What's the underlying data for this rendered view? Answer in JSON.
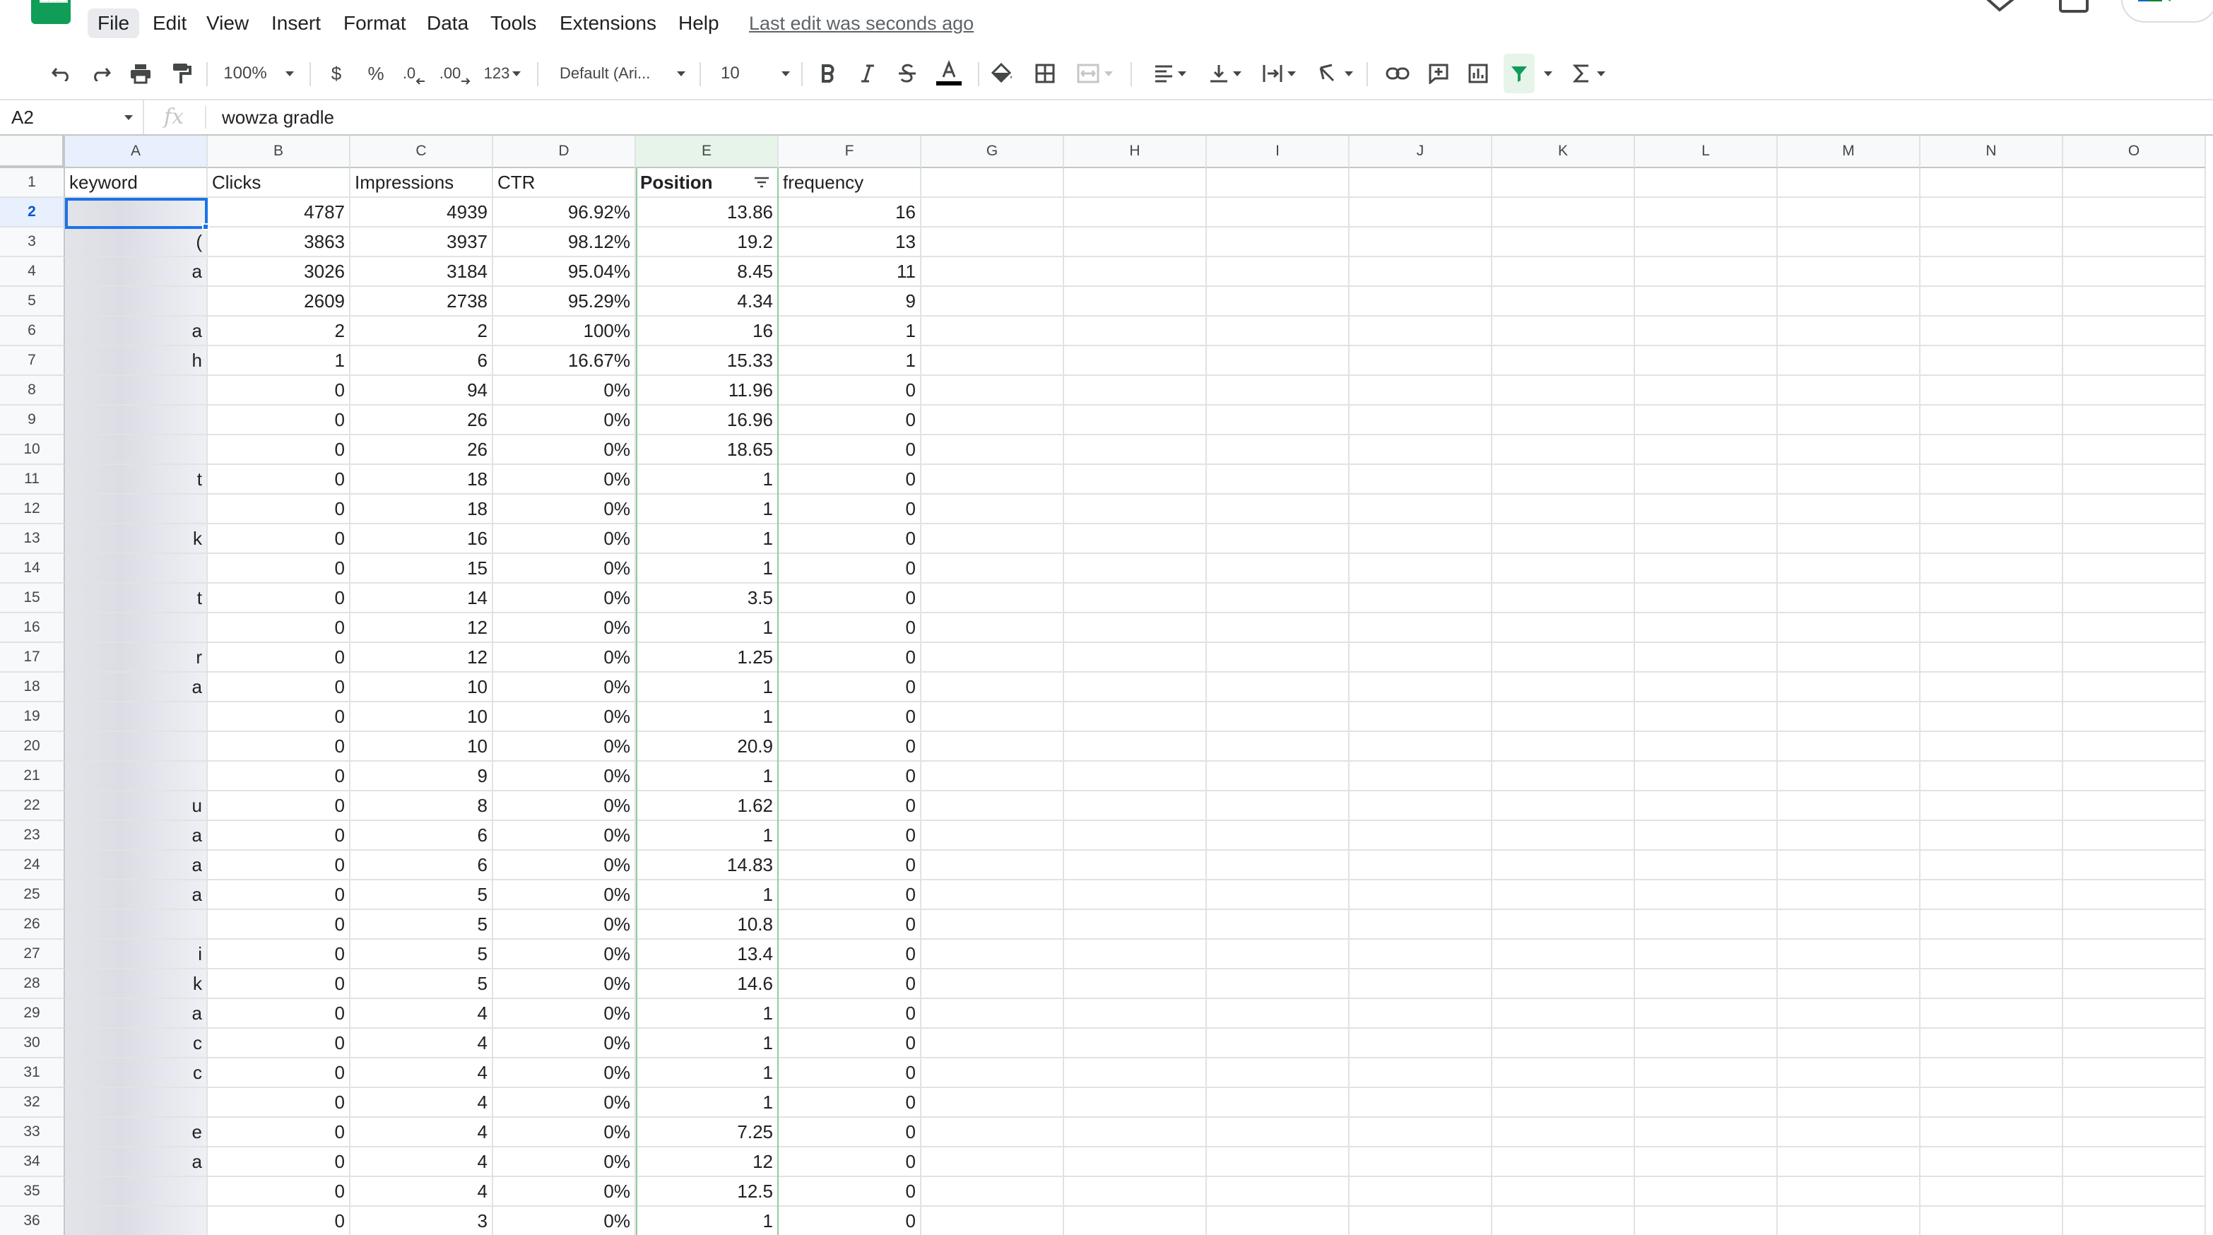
{
  "app": {
    "name": "Google Sheets"
  },
  "menu": {
    "items": [
      "File",
      "Edit",
      "View",
      "Insert",
      "Format",
      "Data",
      "Tools",
      "Extensions",
      "Help"
    ],
    "last_edit": "Last edit was seconds ago"
  },
  "toolbar": {
    "zoom": "100%",
    "currency": "$",
    "percent": "%",
    "decrease_decimals": ".0",
    "increase_decimals": ".00",
    "more_formats": "123",
    "font": "Default (Ari...",
    "font_size": "10"
  },
  "formula_bar": {
    "name_box": "A2",
    "fx": "fx",
    "value": "wowza gradle"
  },
  "colors": {
    "accent": "#1a73e8",
    "filter_active": "#0f9d58",
    "header_bg": "#f8f9fa",
    "grid_line": "#e1e3e1"
  },
  "grid": {
    "columns": [
      "A",
      "B",
      "C",
      "D",
      "E",
      "F",
      "G",
      "H",
      "I",
      "J",
      "K",
      "L",
      "M",
      "N",
      "O"
    ],
    "header_row": [
      "keyword",
      "Clicks",
      "Impressions",
      "CTR",
      "Position",
      "frequency"
    ],
    "row_numbers": [
      "1",
      "2",
      "3",
      "4",
      "5",
      "6",
      "7",
      "8",
      "9",
      "10",
      "11",
      "12",
      "13",
      "14",
      "15",
      "16",
      "17",
      "18",
      "19",
      "20",
      "21",
      "22",
      "23",
      "24",
      "25",
      "26",
      "27",
      "28",
      "29",
      "30",
      "31",
      "32",
      "33",
      "34",
      "35",
      "36"
    ],
    "keyword_tail": [
      "",
      "(",
      "a",
      "",
      "a",
      "h",
      "",
      "",
      "",
      "t",
      "",
      "k",
      "",
      "t",
      "",
      "r",
      "a",
      "",
      "",
      "",
      "u",
      "a",
      "a",
      "a",
      "",
      "i",
      "k",
      "a",
      "c",
      "c",
      "",
      "e",
      "a",
      "",
      ""
    ],
    "rows": [
      [
        "4787",
        "4939",
        "96.92%",
        "13.86",
        "16"
      ],
      [
        "3863",
        "3937",
        "98.12%",
        "19.2",
        "13"
      ],
      [
        "3026",
        "3184",
        "95.04%",
        "8.45",
        "11"
      ],
      [
        "2609",
        "2738",
        "95.29%",
        "4.34",
        "9"
      ],
      [
        "2",
        "2",
        "100%",
        "16",
        "1"
      ],
      [
        "1",
        "6",
        "16.67%",
        "15.33",
        "1"
      ],
      [
        "0",
        "94",
        "0%",
        "11.96",
        "0"
      ],
      [
        "0",
        "26",
        "0%",
        "16.96",
        "0"
      ],
      [
        "0",
        "26",
        "0%",
        "18.65",
        "0"
      ],
      [
        "0",
        "18",
        "0%",
        "1",
        "0"
      ],
      [
        "0",
        "18",
        "0%",
        "1",
        "0"
      ],
      [
        "0",
        "16",
        "0%",
        "1",
        "0"
      ],
      [
        "0",
        "15",
        "0%",
        "1",
        "0"
      ],
      [
        "0",
        "14",
        "0%",
        "3.5",
        "0"
      ],
      [
        "0",
        "12",
        "0%",
        "1",
        "0"
      ],
      [
        "0",
        "12",
        "0%",
        "1.25",
        "0"
      ],
      [
        "0",
        "10",
        "0%",
        "1",
        "0"
      ],
      [
        "0",
        "10",
        "0%",
        "1",
        "0"
      ],
      [
        "0",
        "10",
        "0%",
        "20.9",
        "0"
      ],
      [
        "0",
        "9",
        "0%",
        "1",
        "0"
      ],
      [
        "0",
        "8",
        "0%",
        "1.62",
        "0"
      ],
      [
        "0",
        "6",
        "0%",
        "1",
        "0"
      ],
      [
        "0",
        "6",
        "0%",
        "14.83",
        "0"
      ],
      [
        "0",
        "5",
        "0%",
        "1",
        "0"
      ],
      [
        "0",
        "5",
        "0%",
        "10.8",
        "0"
      ],
      [
        "0",
        "5",
        "0%",
        "13.4",
        "0"
      ],
      [
        "0",
        "5",
        "0%",
        "14.6",
        "0"
      ],
      [
        "0",
        "4",
        "0%",
        "1",
        "0"
      ],
      [
        "0",
        "4",
        "0%",
        "1",
        "0"
      ],
      [
        "0",
        "4",
        "0%",
        "1",
        "0"
      ],
      [
        "0",
        "4",
        "0%",
        "1",
        "0"
      ],
      [
        "0",
        "4",
        "0%",
        "7.25",
        "0"
      ],
      [
        "0",
        "4",
        "0%",
        "12",
        "0"
      ],
      [
        "0",
        "4",
        "0%",
        "12.5",
        "0"
      ],
      [
        "0",
        "3",
        "0%",
        "1",
        "0"
      ]
    ]
  }
}
